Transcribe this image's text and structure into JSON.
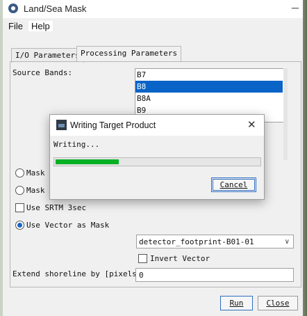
{
  "window": {
    "title": "Land/Sea Mask"
  },
  "menu": {
    "file": "File",
    "help": "Help"
  },
  "tabs": [
    {
      "label": "I/O Parameters",
      "active": false
    },
    {
      "label": "Processing Parameters",
      "active": true
    }
  ],
  "source_bands": {
    "label": "Source Bands:",
    "items": [
      {
        "label": "B7",
        "selected": false
      },
      {
        "label": "B8",
        "selected": true
      },
      {
        "label": "B8A",
        "selected": false
      },
      {
        "label": "B9",
        "selected": false
      }
    ]
  },
  "options": {
    "mask1": {
      "label": "Mask",
      "selected": false
    },
    "mask2": {
      "label": "Mask",
      "selected": false
    },
    "use_srtm": {
      "label": "Use SRTM 3sec",
      "checked": false
    },
    "use_vector": {
      "label": "Use Vector as Mask",
      "selected": true
    }
  },
  "vector_combo": {
    "value": "detector_footprint-B01-01"
  },
  "invert_vector": {
    "label": "Invert Vector",
    "checked": false
  },
  "shoreline": {
    "label": "Extend shoreline by [pixels]:",
    "value": "0"
  },
  "buttons": {
    "run": "Run",
    "close": "Close"
  },
  "dialog": {
    "title": "Writing Target Product",
    "status": "Writing...",
    "progress": 0.31,
    "cancel": "Cancel",
    "progress_color": "#06b025"
  },
  "colors": {
    "selection": "#0a64c8",
    "accent": "#2e6cc0"
  }
}
